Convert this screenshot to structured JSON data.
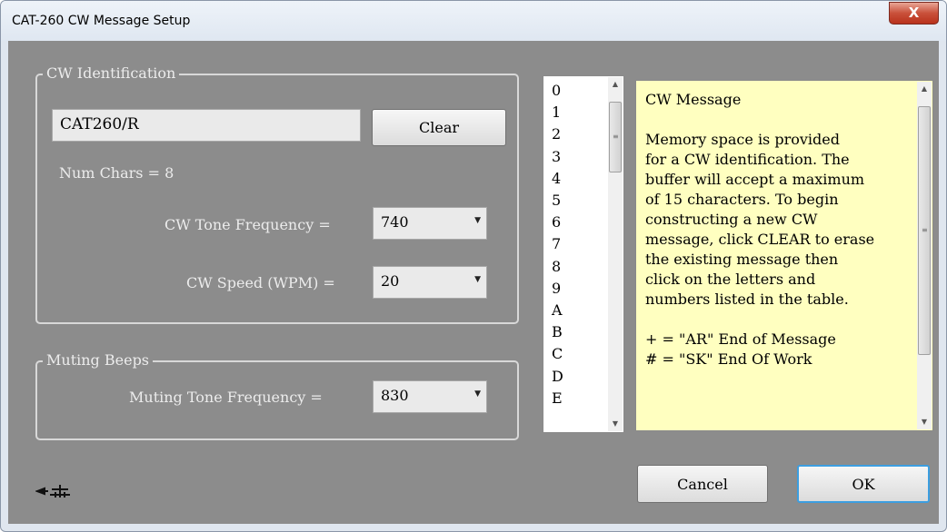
{
  "window": {
    "title": "CAT-260 CW Message Setup",
    "close_glyph": "X"
  },
  "cw_identification": {
    "group_label": "CW Identification",
    "message_value": "CAT260/R",
    "clear_label": "Clear",
    "num_chars_label": "Num Chars = 8",
    "tone_label": "CW Tone Frequency =",
    "tone_value": "740",
    "speed_label": "CW Speed (WPM) =",
    "speed_value": "20"
  },
  "muting_beeps": {
    "group_label": "Muting Beeps",
    "tone_label": "Muting Tone Frequency =",
    "tone_value": "830"
  },
  "char_list": {
    "items": [
      "0",
      "1",
      "2",
      "3",
      "4",
      "5",
      "6",
      "7",
      "8",
      "9",
      "A",
      "B",
      "C",
      "D",
      "E"
    ]
  },
  "help": {
    "lines": [
      "CW Message",
      "",
      "Memory space is provided",
      "for a CW identification. The",
      "buffer will accept a maximum",
      "of 15 characters. To begin",
      "constructing a new CW",
      "message, click CLEAR to erase",
      "the existing message then",
      "click on the letters and",
      "numbers listed in the table.",
      "",
      "+ =  \"AR\"  End of Message",
      "#  =  \"SK\"  End Of Work"
    ]
  },
  "buttons": {
    "cancel_label": "Cancel",
    "ok_label": "OK"
  },
  "icons": {
    "dropdown": "triangle-down",
    "scroll_up": "triangle-up",
    "scroll_down": "triangle-down",
    "logo": "cw-key-logo"
  },
  "colors": {
    "client_bg": "#8c8c8c",
    "help_bg": "#ffffc0",
    "default_button_border": "#3c9ee0",
    "close_button": "#c9503a"
  }
}
